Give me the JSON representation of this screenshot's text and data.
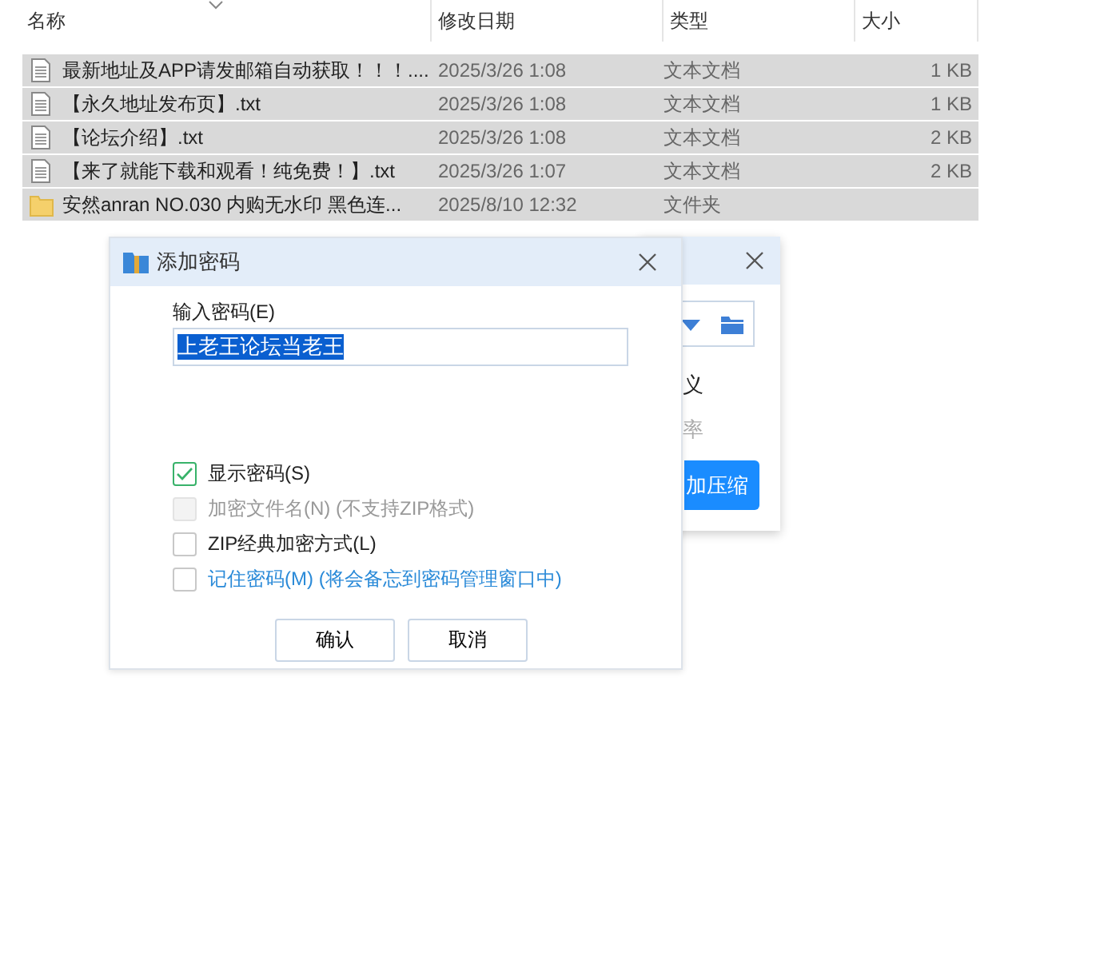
{
  "file_list": {
    "columns": [
      {
        "label": "名称",
        "sorted": true
      },
      {
        "label": "修改日期",
        "sorted": false
      },
      {
        "label": "类型",
        "sorted": false
      },
      {
        "label": "大小",
        "sorted": false
      }
    ],
    "rows": [
      {
        "kind": "file",
        "name": "最新地址及APP请发邮箱自动获取！！！....",
        "date": "2025/3/26 1:08",
        "type": "文本文档",
        "size": "1 KB",
        "selected": true
      },
      {
        "kind": "file",
        "name": "【永久地址发布页】.txt",
        "date": "2025/3/26 1:08",
        "type": "文本文档",
        "size": "1 KB",
        "selected": true
      },
      {
        "kind": "file",
        "name": "【论坛介绍】.txt",
        "date": "2025/3/26 1:08",
        "type": "文本文档",
        "size": "2 KB",
        "selected": true
      },
      {
        "kind": "file",
        "name": "【来了就能下载和观看！纯免费！】.txt",
        "date": "2025/3/26 1:07",
        "type": "文本文档",
        "size": "2 KB",
        "selected": true
      },
      {
        "kind": "folder",
        "name": "安然anran NO.030 内购无水印 黑色连...",
        "date": "2025/8/10 12:32",
        "type": "文件夹",
        "size": "",
        "selected": true
      }
    ]
  },
  "back_window": {
    "texts": [
      "义",
      "率"
    ],
    "button": "加压缩"
  },
  "dialog": {
    "title": "添加密码",
    "password_label": "输入密码(E)",
    "password": "上老王论坛当老王",
    "options": [
      {
        "label": "显示密码(S)",
        "checked": true,
        "disabled": false,
        "kind": "plain"
      },
      {
        "label": "加密文件名(N) (不支持ZIP格式)",
        "checked": false,
        "disabled": true,
        "kind": "plain"
      },
      {
        "label": "ZIP经典加密方式(L)",
        "checked": false,
        "disabled": false,
        "kind": "plain"
      },
      {
        "label": "记住密码(M) (将会备忘到密码管理窗口中)",
        "checked": false,
        "disabled": false,
        "kind": "link"
      }
    ],
    "buttons": [
      "确认",
      "取消"
    ]
  }
}
